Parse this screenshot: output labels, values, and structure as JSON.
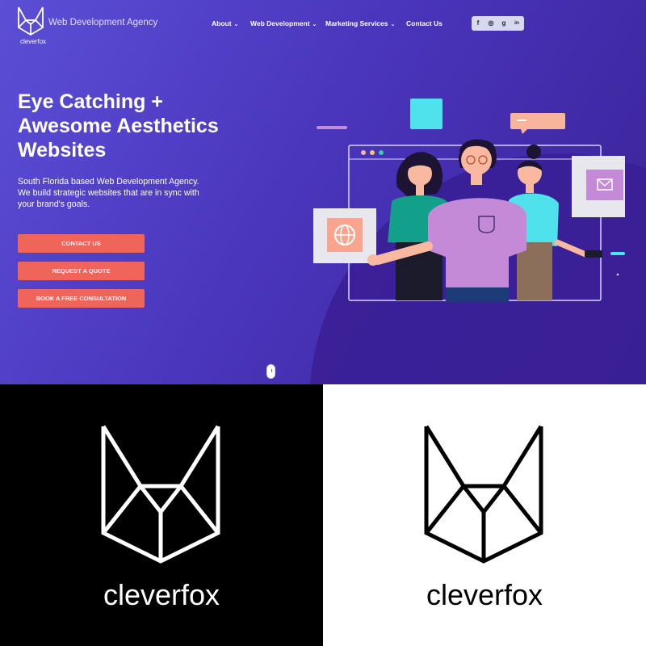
{
  "brand": {
    "name": "cleverfox",
    "tagline": "Web Development Agency"
  },
  "nav": {
    "items": [
      {
        "label": "About",
        "has_dropdown": true
      },
      {
        "label": "Web Development",
        "has_dropdown": true
      },
      {
        "label": "Marketing Services",
        "has_dropdown": true
      },
      {
        "label": "Contact Us",
        "has_dropdown": false
      }
    ],
    "chevron": "⌄"
  },
  "social": {
    "icons": [
      {
        "name": "facebook-icon",
        "glyph": "f"
      },
      {
        "name": "instagram-icon",
        "glyph": "◎"
      },
      {
        "name": "google-plus-icon",
        "glyph": "g"
      },
      {
        "name": "linkedin-icon",
        "glyph": "in"
      }
    ]
  },
  "hero": {
    "headline_lines": [
      "Eye Catching +",
      "Awesome Aesthetics",
      "Websites"
    ],
    "subcopy": "South Florida based Web Development Agency. We build strategic websites that are in sync with your brand's goals.",
    "buttons": [
      "Contact Us",
      "Request A Quote",
      "Book A Free Consultation"
    ]
  },
  "logo_panels": {
    "dark": {
      "wordmark": "cleverfox"
    },
    "light": {
      "wordmark": "cleverfox"
    }
  },
  "colors": {
    "hero_gradient_start": "#5b4fd6",
    "hero_gradient_end": "#3a2196",
    "cta": "#f0655a",
    "teal": "#4fe1ec",
    "peach": "#f9b49d",
    "lavender": "#c48ad8"
  }
}
